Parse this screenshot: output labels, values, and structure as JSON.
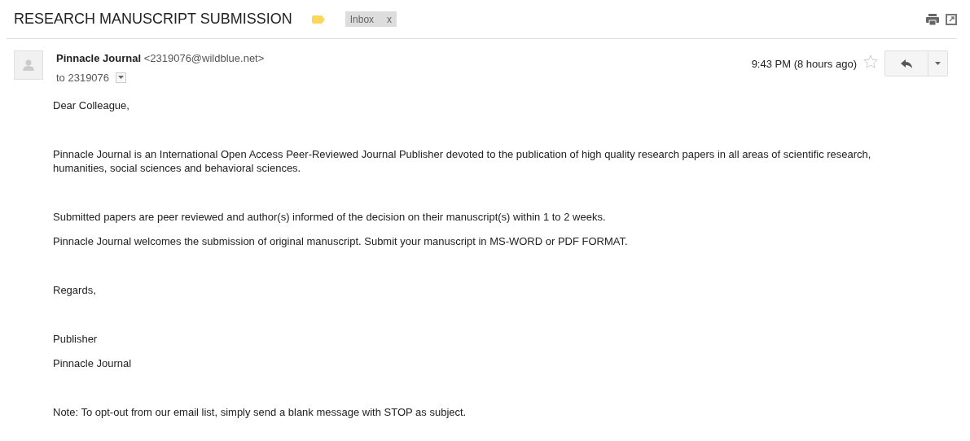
{
  "subject": "RESEARCH MANUSCRIPT SUBMISSION",
  "labels": [
    {
      "text": "Inbox",
      "close": "x"
    }
  ],
  "sender": {
    "name": "Pinnacle Journal",
    "email": "<2319076@wildblue.net>"
  },
  "recipient": "to 2319076",
  "time": "9:43 PM (8 hours ago)",
  "starred": false,
  "body": [
    [
      "Dear Colleague,"
    ],
    [
      "Pinnacle Journal is an International Open Access Peer-Reviewed Journal Publisher devoted to the publication of high quality research papers in all areas of scientific research, humanities, social sciences and behavioral sciences."
    ],
    [
      "Submitted papers are peer reviewed and author(s) informed of the decision on their manuscript(s) within 1 to 2 weeks.",
      "Pinnacle Journal welcomes the submission of original manuscript. Submit your manuscript in MS-WORD or PDF FORMAT."
    ],
    [
      "Regards,"
    ],
    [
      "Publisher",
      "Pinnacle Journal"
    ],
    [
      "Note: To opt-out from our email list, simply send a blank message with STOP as subject."
    ]
  ]
}
